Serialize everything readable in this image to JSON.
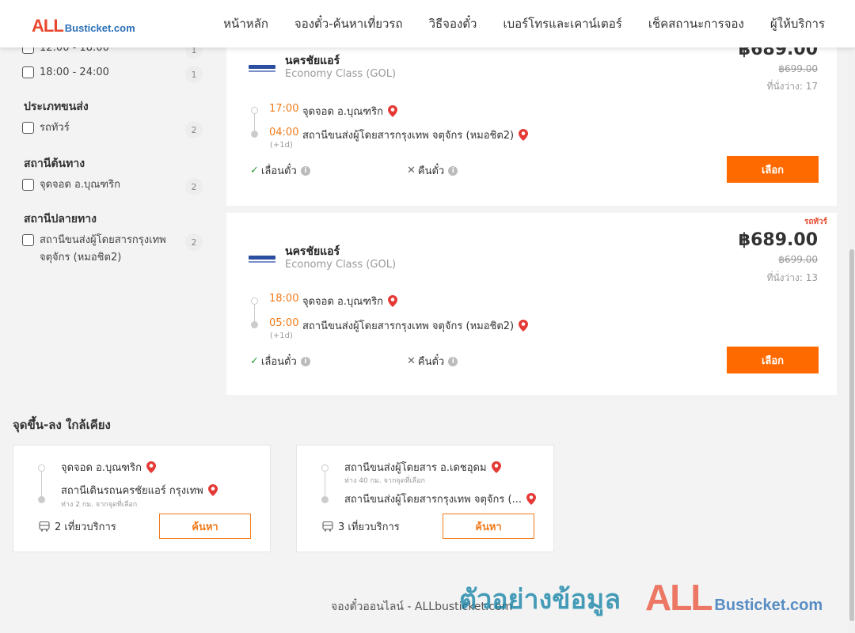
{
  "header": {
    "logo_all": "ALL",
    "logo_busticket": "Busticket.com",
    "nav": [
      "หน้าหลัก",
      "จองตั๋ว-ค้นหาเที่ยวรถ",
      "วิธีจองตั๋ว",
      "เบอร์โทรและเคาน์เตอร์",
      "เช็คสถานะการจอง",
      "ผู้ให้บริการ"
    ]
  },
  "filters": {
    "time_options": [
      {
        "label": "12:00 - 18:00",
        "count": "1"
      },
      {
        "label": "18:00 - 24:00",
        "count": "1"
      }
    ],
    "transport_type": {
      "title": "ประเภทขนส่ง",
      "options": [
        {
          "label": "รถทัวร์",
          "count": "2"
        }
      ]
    },
    "origin": {
      "title": "สถานีต้นทาง",
      "options": [
        {
          "label": "จุดจอด อ.บุณฑริก",
          "count": "2"
        }
      ]
    },
    "destination": {
      "title": "สถานีปลายทาง",
      "options": [
        {
          "label": "สถานีขนส่งผู้โดยสารกรุงเทพ จตุจักร (หมอชิต2)",
          "count": "2"
        }
      ]
    }
  },
  "trips": [
    {
      "operator": "นครชัยแอร์",
      "class": "Economy Class (GOL)",
      "price": "฿689.00",
      "old_price": "฿699.00",
      "seats": "ที่นั่งว่าง: 17",
      "badge": "",
      "depart_time": "17:00",
      "depart_place": "จุดจอด อ.บุณฑริก",
      "arrive_time": "04:00",
      "arrive_place": "สถานีขนส่งผู้โดยสารกรุงเทพ จตุจักร (หมอชิต2)",
      "next_day": "(+1d)",
      "feature_change": "เลื่อนตั๋ว",
      "feature_refund": "คืนตั๋ว",
      "select_label": "เลือก"
    },
    {
      "operator": "นครชัยแอร์",
      "class": "Economy Class (GOL)",
      "price": "฿689.00",
      "old_price": "฿699.00",
      "seats": "ที่นั่งว่าง: 13",
      "badge": "รถทัวร์",
      "depart_time": "18:00",
      "depart_place": "จุดจอด อ.บุณฑริก",
      "arrive_time": "05:00",
      "arrive_place": "สถานีขนส่งผู้โดยสารกรุงเทพ จตุจักร (หมอชิต2)",
      "next_day": "(+1d)",
      "feature_change": "เลื่อนตั๋ว",
      "feature_refund": "คืนตั๋ว",
      "select_label": "เลือก"
    }
  ],
  "nearby": {
    "title": "จุดขึ้น-ลง ใกล้เคียง",
    "cards": [
      {
        "from": "จุดจอด อ.บุณฑริก",
        "from_sub": "",
        "to": "สถานีเดินรถนครชัยแอร์ กรุงเทพ",
        "to_sub": "ห่าง 2 กม. จากจุดที่เลือก",
        "trips": "2 เที่ยวบริการ",
        "search_label": "ค้นหา"
      },
      {
        "from": "สถานีขนส่งผู้โดยสาร อ.เดชอุดม",
        "from_sub": "ห่าง 40 กม. จากจุดที่เลือก",
        "to": "สถานีขนส่งผู้โดยสารกรุงเทพ จตุจักร (...",
        "to_sub": "",
        "trips": "3 เที่ยวบริการ",
        "search_label": "ค้นหา"
      }
    ]
  },
  "footer": {
    "text": "จองตั๋วออนไลน์ - ALLbusticket.com",
    "watermark_text": "ตัวอย่างข้อมูล",
    "watermark_all": "ALL",
    "watermark_busticket": "Busticket.com"
  },
  "colors": {
    "accent": "#ff6a00",
    "time": "#f27a1a",
    "logo_red": "#e8472d",
    "logo_blue": "#2b6fb6"
  }
}
